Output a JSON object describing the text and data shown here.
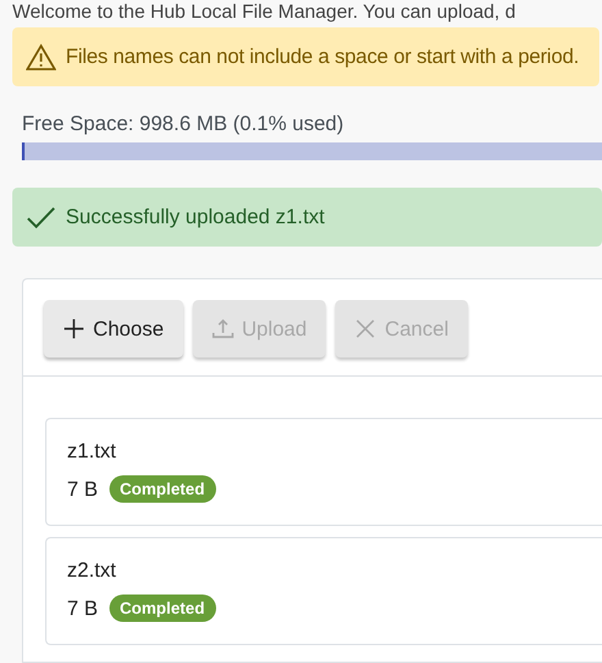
{
  "intro": "Welcome to the Hub Local File Manager. You can upload, d",
  "warning": {
    "text": "Files names can not include a space or start with a period."
  },
  "storage": {
    "label": "Free Space: 998.6 MB (0.1% used)",
    "level": 0.001
  },
  "success": {
    "text": "Successfully uploaded z1.txt"
  },
  "toolbar": [
    {
      "kind": "choose",
      "label": "Choose",
      "disabled": false
    },
    {
      "kind": "upload",
      "label": "Upload",
      "disabled": true
    },
    {
      "kind": "cancel",
      "label": "Cancel",
      "disabled": true
    }
  ],
  "files": [
    {
      "name": "z1.txt",
      "size": "7 B",
      "status": "Completed"
    },
    {
      "name": "z2.txt",
      "size": "7 B",
      "status": "Completed"
    }
  ]
}
